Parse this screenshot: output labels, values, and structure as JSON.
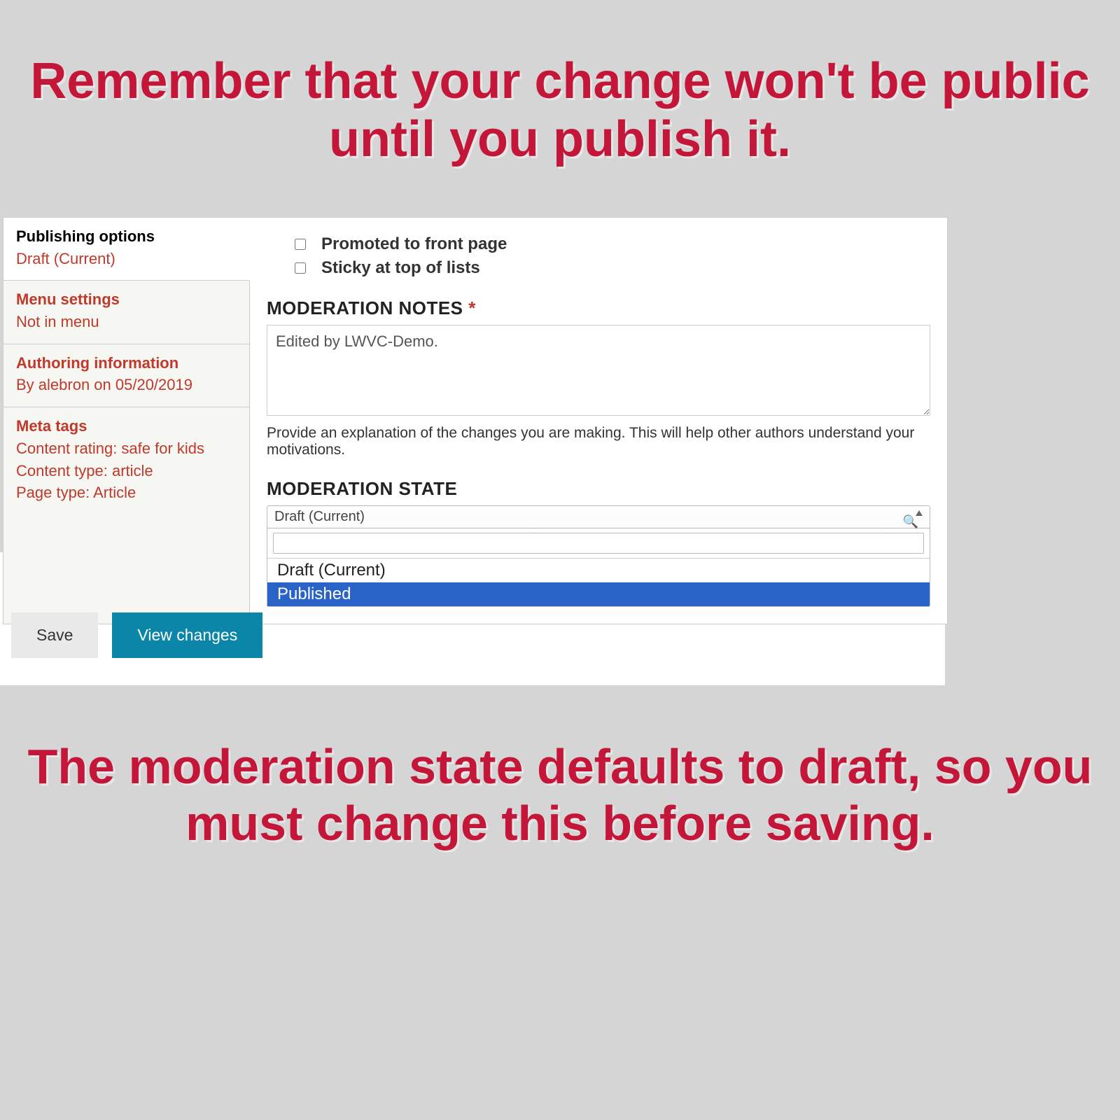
{
  "banner_top": "Remember that your change won't be public until you publish it.",
  "banner_bottom": "The moderation state defaults to draft, so you must change this before saving.",
  "tabs": {
    "publishing": {
      "title": "Publishing options",
      "sub": "Draft (Current)"
    },
    "menu": {
      "title": "Menu settings",
      "sub": "Not in menu"
    },
    "authoring": {
      "title": "Authoring information",
      "sub": "By alebron on 05/20/2019"
    },
    "meta": {
      "title": "Meta tags",
      "sub1": "Content rating: safe for kids",
      "sub2": "Content type: article",
      "sub3": "Page type: Article"
    }
  },
  "checks": {
    "promoted": "Promoted to front page",
    "sticky": "Sticky at top of lists"
  },
  "notes": {
    "label": "MODERATION NOTES",
    "value": "Edited by LWVC-Demo.",
    "help": "Provide an explanation of the changes you are making. This will help other authors understand your motivations."
  },
  "state": {
    "label": "MODERATION STATE",
    "current": "Draft (Current)",
    "options": {
      "draft": "Draft (Current)",
      "published": "Published"
    }
  },
  "buttons": {
    "save": "Save",
    "view": "View changes"
  }
}
